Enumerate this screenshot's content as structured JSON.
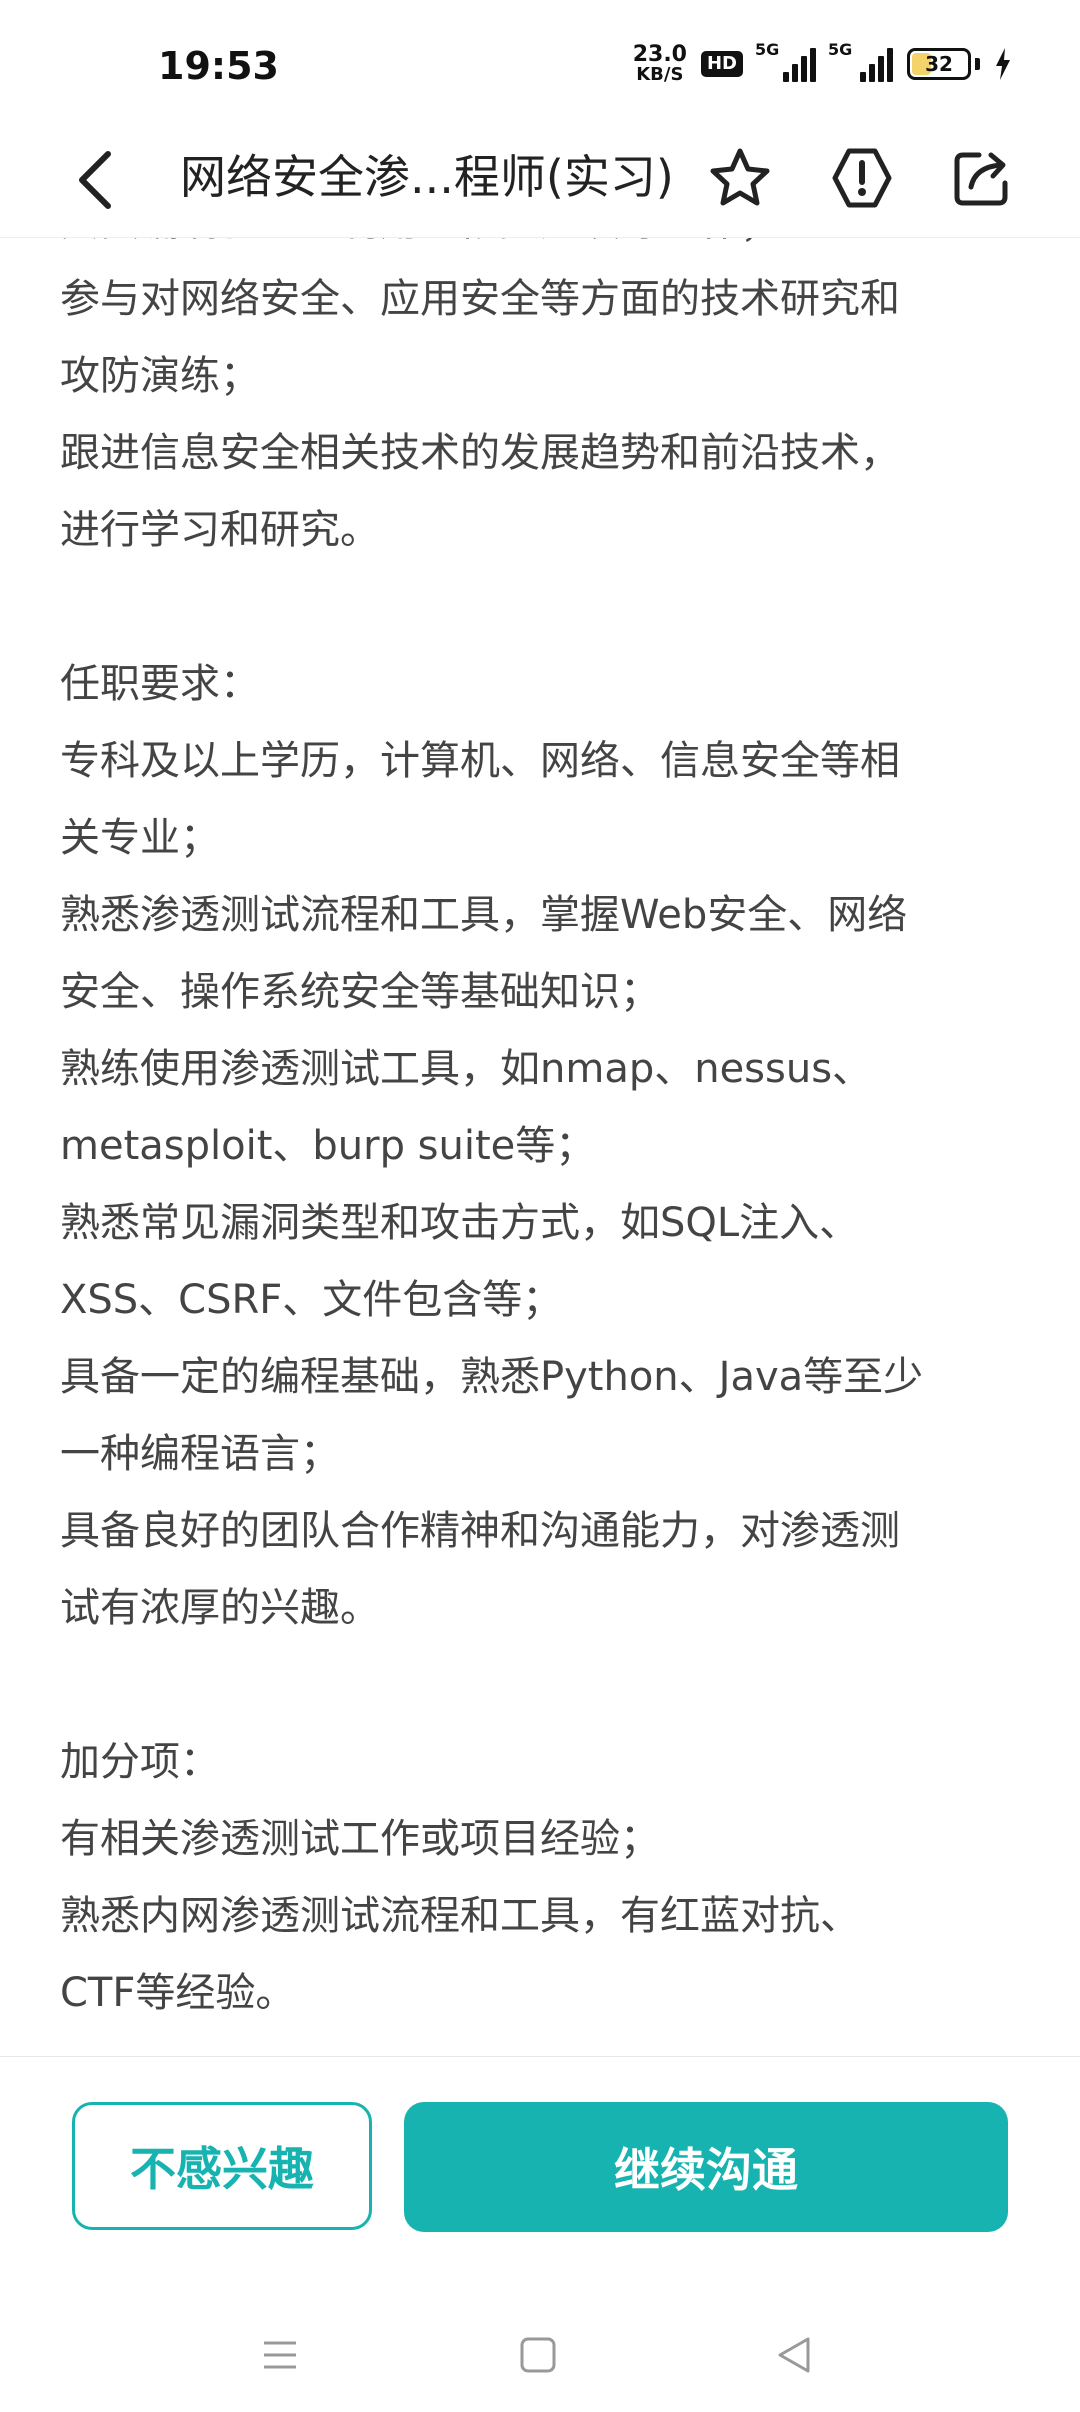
{
  "status_bar": {
    "time": "19:53",
    "net_speed_value": "23.0",
    "net_speed_unit": "KB/S",
    "hd_label": "HD",
    "signal1_label": "5G",
    "signal2_label": "5G",
    "battery_level": "32"
  },
  "header": {
    "title": "网络安全渗...程师(实习)",
    "icons": [
      "back-icon",
      "star-icon",
      "report-icon",
      "share-icon"
    ]
  },
  "content": {
    "lines": [
      "负责漏洞验证、利用、修复建议等工作；",
      "参与对网络安全、应用安全等方面的技术研究和",
      "攻防演练；",
      "跟进信息安全相关技术的发展趋势和前沿技术，",
      "进行学习和研究。",
      "",
      "任职要求：",
      "专科及以上学历，计算机、网络、信息安全等相",
      "关专业；",
      "熟悉渗透测试流程和工具，掌握Web安全、网络",
      "安全、操作系统安全等基础知识；",
      "熟练使用渗透测试工具，如nmap、nessus、",
      "metasploit、burp suite等；",
      "熟悉常见漏洞类型和攻击方式，如SQL注入、",
      "XSS、CSRF、文件包含等；",
      "具备一定的编程基础，熟悉Python、Java等至少",
      "一种编程语言；",
      "具备良好的团队合作精神和沟通能力，对渗透测",
      "试有浓厚的兴趣。",
      "",
      "加分项：",
      "有相关渗透测试工作或项目经验；",
      "熟悉内网渗透测试流程和工具，有红蓝对抗、",
      "CTF等经验。"
    ]
  },
  "actions": {
    "not_interested_label": "不感兴趣",
    "continue_label": "继续沟通"
  },
  "colors": {
    "accent": "#17b3b0",
    "text": "#444444",
    "battery_fill": "#f3d36a"
  }
}
